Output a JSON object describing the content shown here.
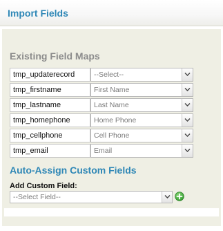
{
  "header": {
    "title": "Import Fields"
  },
  "existing": {
    "title": "Existing Field Maps",
    "rows": [
      {
        "field": "tmp_updaterecord",
        "selected": "--Select--"
      },
      {
        "field": "tmp_firstname",
        "selected": "First Name"
      },
      {
        "field": "tmp_lastname",
        "selected": "Last Name"
      },
      {
        "field": "tmp_homephone",
        "selected": "Home Phone"
      },
      {
        "field": "tmp_cellphone",
        "selected": "Cell Phone"
      },
      {
        "field": "tmp_email",
        "selected": "Email"
      }
    ]
  },
  "auto_assign": {
    "title": "Auto-Assign Custom Fields",
    "add_label": "Add Custom Field:",
    "select_value": "--Select Field--",
    "add_icon": "plus-circle-icon"
  },
  "colors": {
    "accent": "#2e87b6",
    "panel_bg": "#efefe4",
    "muted_heading": "#8c8c8c",
    "add_green": "#3aa33a"
  }
}
